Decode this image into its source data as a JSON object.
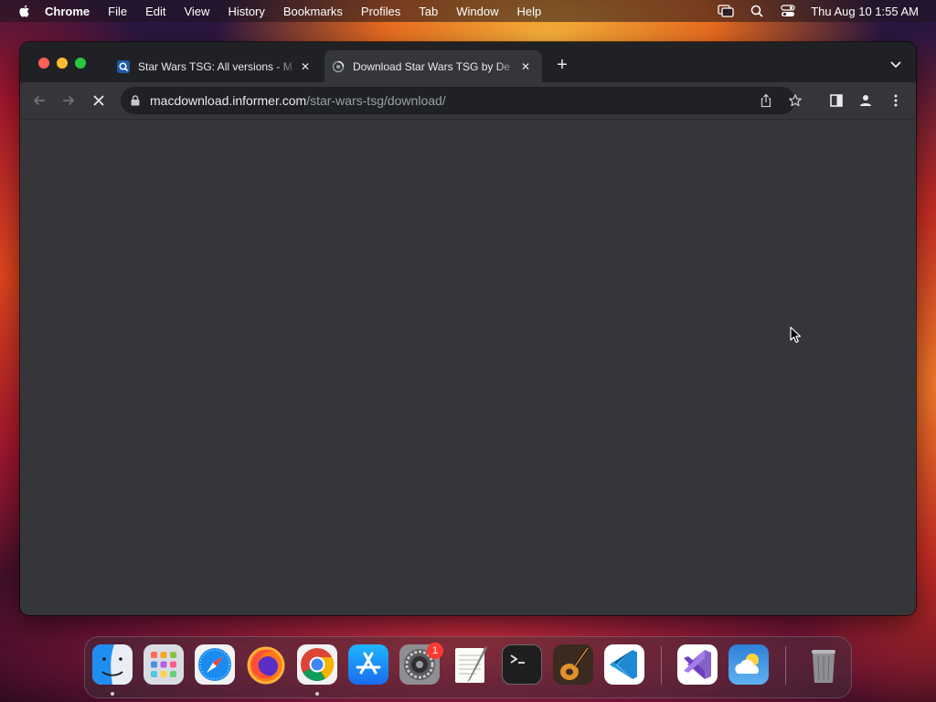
{
  "menubar": {
    "app_name": "Chrome",
    "items": [
      "File",
      "Edit",
      "View",
      "History",
      "Bookmarks",
      "Profiles",
      "Tab",
      "Window",
      "Help"
    ],
    "clock": "Thu Aug 10  1:55 AM"
  },
  "browser": {
    "tabs": [
      {
        "title": "Star Wars TSG: All versions - M",
        "active": false,
        "favicon": "search-favicon-icon"
      },
      {
        "title": "Download Star Wars TSG by De",
        "active": true,
        "favicon": "loading-globe-icon"
      }
    ],
    "address": {
      "domain": "macdownload.informer.com",
      "path": "/star-wars-tsg/download/"
    }
  },
  "dock": {
    "apps": [
      {
        "name": "Finder",
        "icon": "finder-icon",
        "running": true
      },
      {
        "name": "Launchpad",
        "icon": "launchpad-icon",
        "running": false
      },
      {
        "name": "Safari",
        "icon": "safari-icon",
        "running": false
      },
      {
        "name": "Firefox",
        "icon": "firefox-icon",
        "running": false
      },
      {
        "name": "Google Chrome",
        "icon": "chrome-icon",
        "running": true
      },
      {
        "name": "App Store",
        "icon": "app-store-icon",
        "running": false
      },
      {
        "name": "System Settings",
        "icon": "system-settings-icon",
        "running": false,
        "badge": "1"
      },
      {
        "name": "TextEdit",
        "icon": "textedit-icon",
        "running": false
      },
      {
        "name": "Terminal",
        "icon": "terminal-icon",
        "running": false
      },
      {
        "name": "GarageBand",
        "icon": "garageband-icon",
        "running": false
      },
      {
        "name": "Visual Studio Code",
        "icon": "vscode-icon",
        "running": false
      },
      {
        "name": "Visual Studio",
        "icon": "visual-studio-icon",
        "running": false
      },
      {
        "name": "Weather",
        "icon": "weather-icon",
        "running": false
      },
      {
        "name": "Trash",
        "icon": "trash-icon",
        "running": false
      }
    ]
  },
  "colors": {
    "window_bg": "#35363a",
    "tabstrip_bg": "#202124",
    "text_primary": "#e8eaed",
    "text_secondary": "#9aa0a6"
  }
}
